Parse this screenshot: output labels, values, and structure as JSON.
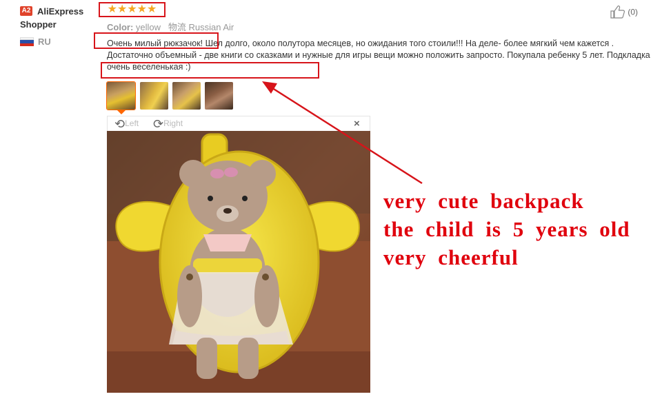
{
  "user": {
    "badge": "A2",
    "name_line1": "AliExpress",
    "name_line2": "Shopper",
    "country": "RU"
  },
  "rating": {
    "stars": "★★★★★",
    "value": 5,
    "max": 5
  },
  "attributes": {
    "color_label": "Color:",
    "color_value": "yellow",
    "shipping_label": "物流",
    "shipping_value": "Russian Air"
  },
  "review": {
    "sentence1": "Очень милый рюкзачок!",
    "sentence2": " Шел долго, около полутора месяцев, но ожидания того стоили!!! На деле- более мягкий чем кажется . Достаточно объемный - две книги со сказками и нужные для игры вещи можно положить запросто. Покупала ",
    "sentence3": "ребенку 5 лет. Подкладка очень веселенькая :)"
  },
  "helpful": {
    "count": "(0)"
  },
  "viewer": {
    "rotate_left": "Left",
    "rotate_right": "Right",
    "close": "×"
  },
  "annotation": {
    "line1": "very cute backpack",
    "line2": "the child is 5 years old",
    "line3": "very cheerful"
  },
  "colors": {
    "highlight_red": "#d7141a",
    "star_orange": "#f5a623",
    "annotation_red": "#e0000d"
  }
}
